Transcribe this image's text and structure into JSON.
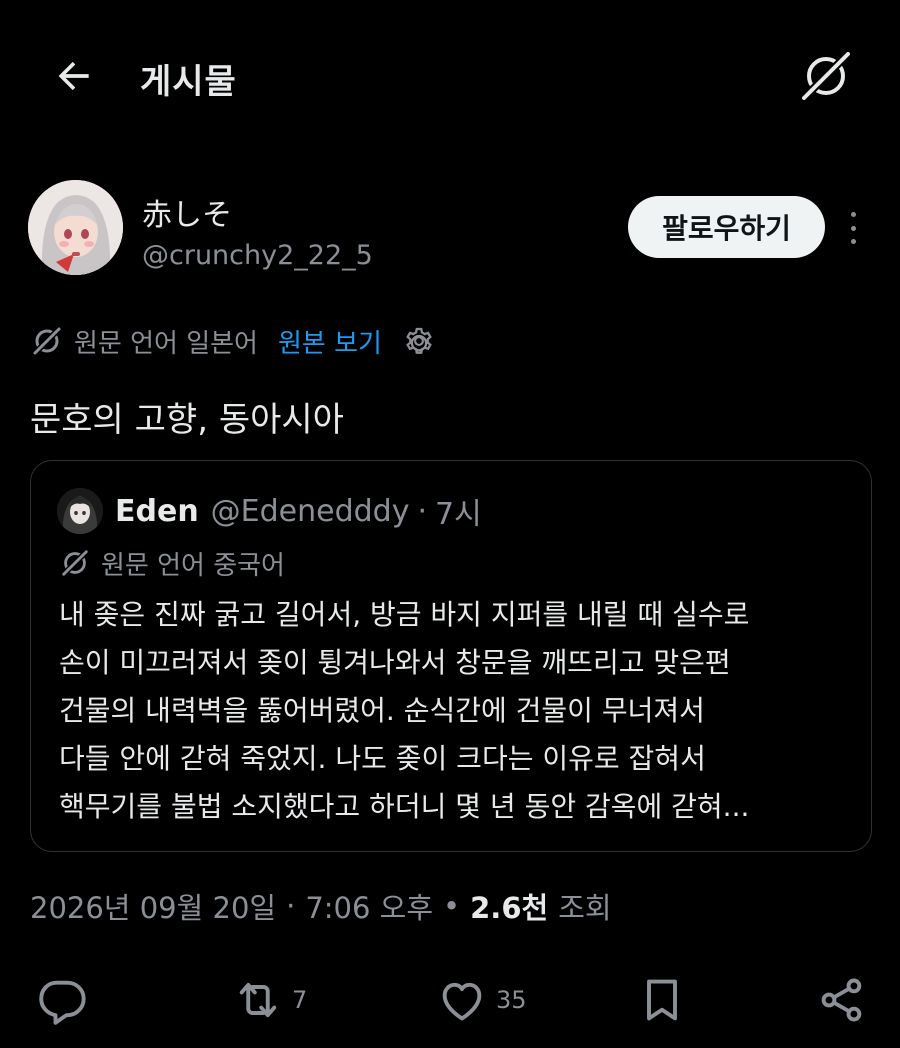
{
  "header": {
    "title": "게시물",
    "back_icon": "arrow-left-icon",
    "grok_icon": "grok-icon"
  },
  "author": {
    "display_name": "赤しそ",
    "handle": "@crunchy2_22_5",
    "follow_label": "팔로우하기",
    "more_icon": "more-vertical-icon"
  },
  "translation": {
    "label": "원문 언어 일본어",
    "show_original": "원본 보기",
    "settings_icon": "gear-icon"
  },
  "tweet": {
    "text": "문호의 고향, 동아시아"
  },
  "quote": {
    "name": "Eden",
    "handle": "@Edenedddy",
    "dot": "·",
    "time": "7시",
    "translation_label": "원문 언어 중국어",
    "lines": [
      "내 좆은 진짜 굵고 길어서, 방금 바지 지퍼를 내릴 때 실수로",
      "손이 미끄러져서 좆이 튕겨나와서 창문을 깨뜨리고 맞은편",
      "건물의 내력벽을 뚫어버렸어. 순식간에 건물이 무너져서",
      "다들 안에 갇혀 죽었지. 나도 좆이 크다는 이유로 잡혀서",
      "핵무기를 불법 소지했다고 하더니 몇 년 동안 감옥에 갇혀..."
    ]
  },
  "meta": {
    "date": "2026년 09월 20일",
    "sep1": "·",
    "time": "7:06 오후",
    "sep2": "•",
    "views_count": "2.6천",
    "views_label": "조회"
  },
  "actions": {
    "reply_icon": "reply-icon",
    "retweet_icon": "retweet-icon",
    "retweet_count": "7",
    "like_icon": "heart-icon",
    "like_count": "35",
    "bookmark_icon": "bookmark-icon",
    "share_icon": "share-icon"
  },
  "colors": {
    "background": "#000000",
    "text": "#e7e9ea",
    "muted": "#8b9097",
    "link": "#1d9bf0",
    "border": "#2f3336"
  }
}
